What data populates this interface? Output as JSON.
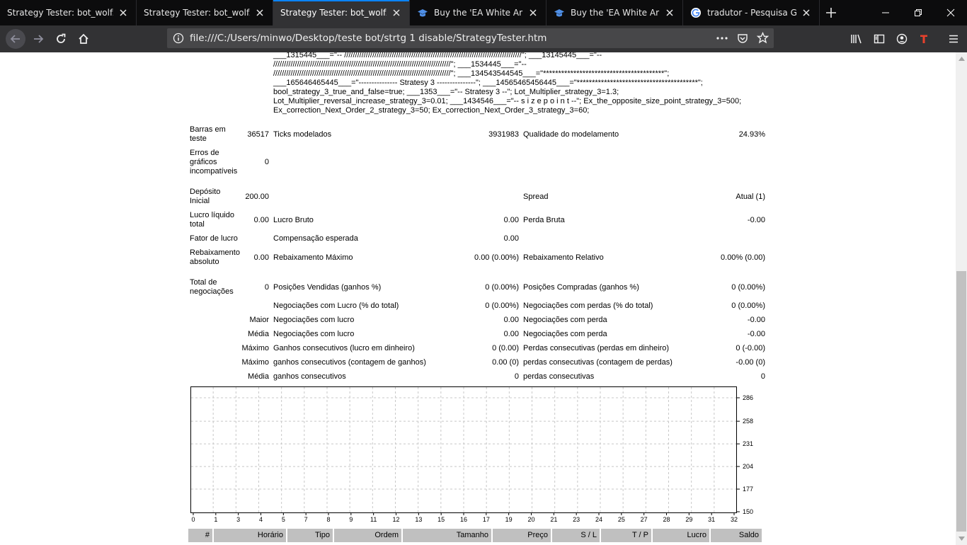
{
  "browser": {
    "tabs": [
      {
        "title": "Strategy Tester: bot_wolfzeacl",
        "active": false,
        "icon": "page-icon"
      },
      {
        "title": "Strategy Tester: bot_wolfzeacl",
        "active": false,
        "icon": "page-icon"
      },
      {
        "title": "Strategy Tester: bot_wolfzeacl",
        "active": true,
        "icon": "page-icon"
      },
      {
        "title": "Buy the 'EA White Arbitra",
        "active": false,
        "icon": "graduation-cap-icon"
      },
      {
        "title": "Buy the 'EA White Arbitra",
        "active": false,
        "icon": "graduation-cap-icon"
      },
      {
        "title": "tradutor - Pesquisa Goog",
        "active": false,
        "icon": "google-icon"
      }
    ],
    "url": "file:///C:/Users/minwo/Desktop/teste bot/strtg 1 disable/StrategyTester.htm",
    "accent_color": "#0a84ff"
  },
  "params_lines": [
    "___1315445___=\"-- //////////////////////////////////////////////////////////////////////////////////\"; ___13145445___=\"--",
    "//////////////////////////////////////////////////////////////////////////////////\"; ___1534445___=\"--",
    "//////////////////////////////////////////////////////////////////////////////////\"; ___134543544545___=\"****************************************\";",
    "___165646465445___=\"--------------- Stratesy 3 ---------------\"; ___14565465456445___=\"****************************************\";",
    "bool_strategy_3_true_and_false=true; ___1353___=\"-- Stratesy 3 --\"; Lot_Multiplier_strategy_3=1.3;",
    "Lot_Multiplier_reversal_increase_strategy_3=0.01; ___1434546___=\"-- s i z e p o i n t --\"; Ex_the_opposite_size_point_strategy_3=500;",
    "Ex_correction_Next_Order_2_strategy_3=50; Ex_correction_Next_Order_3_strategy_3=60;"
  ],
  "report": {
    "barras_label": "Barras em teste",
    "barras_value": "36517",
    "ticks_label": "Ticks modelados",
    "ticks_value": "3931983",
    "qualidade_label": "Qualidade do modelamento",
    "qualidade_value": "24.93%",
    "erros_label": "Erros de gráficos incompatíveis",
    "erros_value": "0",
    "deposito_label": "Depósito Inicial",
    "deposito_value": "200.00",
    "spread_label": "Spread",
    "spread_value": "Atual (1)",
    "lucro_liquido_label": "Lucro líquido total",
    "lucro_liquido_value": "0.00",
    "lucro_bruto_label": "Lucro Bruto",
    "lucro_bruto_value": "0.00",
    "perda_bruta_label": "Perda Bruta",
    "perda_bruta_value": "-0.00",
    "fator_label": "Fator de lucro",
    "compensacao_label": "Compensação esperada",
    "compensacao_value": "0.00",
    "rebaix_abs_label": "Rebaixamento absoluto",
    "rebaix_abs_value": "0.00",
    "rebaix_max_label": "Rebaixamento Máximo",
    "rebaix_max_value": "0.00 (0.00%)",
    "rebaix_rel_label": "Rebaixamento Relativo",
    "rebaix_rel_value": "0.00% (0.00)",
    "total_neg_label": "Total de negociações",
    "total_neg_value": "0",
    "pos_vend_label": "Posições Vendidas (ganhos %)",
    "pos_vend_value": "0 (0.00%)",
    "pos_comp_label": "Posições Compradas (ganhos %)",
    "pos_comp_value": "0 (0.00%)",
    "neg_lucro_label": "Negociações com Lucro (% do total)",
    "neg_lucro_value": "0 (0.00%)",
    "neg_perdas_label": "Negociações com perdas (% do total)",
    "neg_perdas_value": "0 (0.00%)",
    "maior_label": "Maior",
    "maior_lucro_label": "Negociações com lucro",
    "maior_lucro_value": "0.00",
    "maior_perda_label": "Negociações com perda",
    "maior_perda_value": "-0.00",
    "media_label": "Média",
    "media_lucro_label": "Negociações com lucro",
    "media_lucro_value": "0.00",
    "media_perda_label": "Negociações com perda",
    "media_perda_value": "-0.00",
    "maximo1_label": "Máximo",
    "ganhos_consec_label": "Ganhos consecutivos (lucro em dinheiro)",
    "ganhos_consec_value": "0 (0.00)",
    "perdas_consec_label": "Perdas consecutivas (perdas em dinheiro)",
    "perdas_consec_value": "0 (-0.00)",
    "maximo2_label": "Máximo",
    "ganhos_consec2_label": "ganhos consecutivos (contagem de ganhos)",
    "ganhos_consec2_value": "0.00 (0)",
    "perdas_consec2_label": "perdas consecutivas (contagem de perdas)",
    "perdas_consec2_value": "-0.00 (0)",
    "media2_label": "Média",
    "ganhos_consec3_label": "ganhos consecutivos",
    "ganhos_consec3_value": "0",
    "perdas_consec3_label": "perdas consecutivas",
    "perdas_consec3_value": "0"
  },
  "chart_data": {
    "type": "line",
    "x_ticks": [
      "0",
      "1",
      "3",
      "4",
      "5",
      "7",
      "8",
      "9",
      "11",
      "12",
      "13",
      "15",
      "16",
      "17",
      "19",
      "20",
      "21",
      "23",
      "24",
      "25",
      "27",
      "28",
      "29",
      "31",
      "32"
    ],
    "y_ticks": [
      "286",
      "258",
      "231",
      "204",
      "177",
      "150"
    ],
    "ylim": [
      150,
      286
    ],
    "grid": true,
    "series": []
  },
  "trades_table": {
    "headers": [
      "#",
      "Horário",
      "Tipo",
      "Ordem",
      "Tamanho",
      "Preço",
      "S / L",
      "T / P",
      "Lucro",
      "Saldo"
    ]
  }
}
